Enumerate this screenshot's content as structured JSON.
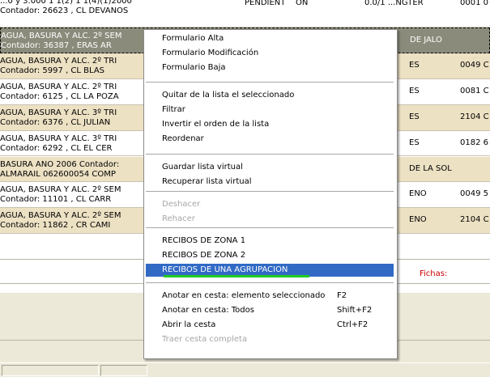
{
  "list": {
    "top_partial": {
      "line1": "...0 y 3.000 1 1(2) 1 1(4)(1)2000",
      "line2": "Contador: 26623 , CL    DEVANOS",
      "col_a": "PENDIENT",
      "col_b": "ON",
      "col_c": "0.0/1 ...NGTER",
      "col_d": "0001 0"
    },
    "rows": [
      {
        "line1": "AGUA, BASURA Y ALC. 2º SEM",
        "line2": "Contador: 36387 ,   ERAS AR",
        "right1": "DE JALO",
        "right2": ""
      },
      {
        "line1": "AGUA, BASURA Y ALC. 2º TRI",
        "line2": "Contador: 5997 , CL   BLAS",
        "right1": "ES",
        "right2": "0049 C"
      },
      {
        "line1": "AGUA, BASURA Y ALC. 2º TRI",
        "line2": "Contador: 6125 , CL LA POZA",
        "right1": "ES",
        "right2": "0081 C"
      },
      {
        "line1": "AGUA, BASURA Y ALC. 3º TRI",
        "line2": "Contador: 6376 , CL   JULIAN",
        "right1": "ES",
        "right2": "2104 C"
      },
      {
        "line1": "AGUA, BASURA Y ALC. 3º TRI",
        "line2": "Contador: 6292 , CL   EL CER",
        "right1": "ES",
        "right2": "0182 6"
      },
      {
        "line1": "BASURA AÑO 2006 Contador:",
        "line2": "ALMARAIL  062600054 COMP",
        "right1": "DE LA SOL",
        "right2": ""
      },
      {
        "line1": "AGUA, BASURA Y ALC. 2º SEM",
        "line2": "Contador: 11101 , CL   CARR",
        "right1": "ENO",
        "right2": "0049 5"
      },
      {
        "line1": "AGUA, BASURA Y ALC. 2º SEM",
        "line2": "Contador: 11862 , CR   CAMI",
        "right1": "ENO",
        "right2": "2104 C"
      }
    ],
    "fichas_label": "Fichas:"
  },
  "menu": {
    "items": [
      {
        "label": "Formulario Alta",
        "shortcut": "",
        "enabled": true
      },
      {
        "label": "Formulario Modificación",
        "shortcut": "",
        "enabled": true
      },
      {
        "label": "Formulario Baja",
        "shortcut": "",
        "enabled": true
      },
      {
        "label": "Quitar de la lista el seleccionado",
        "shortcut": "",
        "enabled": true
      },
      {
        "label": "Filtrar",
        "shortcut": "",
        "enabled": true
      },
      {
        "label": "Invertir el orden de la lista",
        "shortcut": "",
        "enabled": true
      },
      {
        "label": "Reordenar",
        "shortcut": "",
        "enabled": true
      },
      {
        "label": "Guardar lista virtual",
        "shortcut": "",
        "enabled": true
      },
      {
        "label": "Recuperar lista virtual",
        "shortcut": "",
        "enabled": true
      },
      {
        "label": "Deshacer",
        "shortcut": "",
        "enabled": false
      },
      {
        "label": "Rehacer",
        "shortcut": "",
        "enabled": false
      },
      {
        "label": "RECIBOS DE ZONA 1",
        "shortcut": "",
        "enabled": true
      },
      {
        "label": "RECIBOS DE ZONA 2",
        "shortcut": "",
        "enabled": true
      },
      {
        "label": "RECIBOS DE UNA AGRUPACION",
        "shortcut": "",
        "enabled": true,
        "highlighted": true
      },
      {
        "label": "Anotar en cesta: elemento seleccionado",
        "shortcut": "F2",
        "enabled": true
      },
      {
        "label": "Anotar en cesta: Todos",
        "shortcut": "Shift+F2",
        "enabled": true
      },
      {
        "label": "Abrir la cesta",
        "shortcut": "Ctrl+F2",
        "enabled": true
      },
      {
        "label": "Traer cesta completa",
        "shortcut": "",
        "enabled": false
      }
    ]
  },
  "colors": {
    "row_tan": "#ede1c4",
    "row_selected": "#8b8b7b",
    "menu_highlight": "#316ac5",
    "highlight_underline": "#22cc22",
    "fichas_red": "#cc0000"
  }
}
